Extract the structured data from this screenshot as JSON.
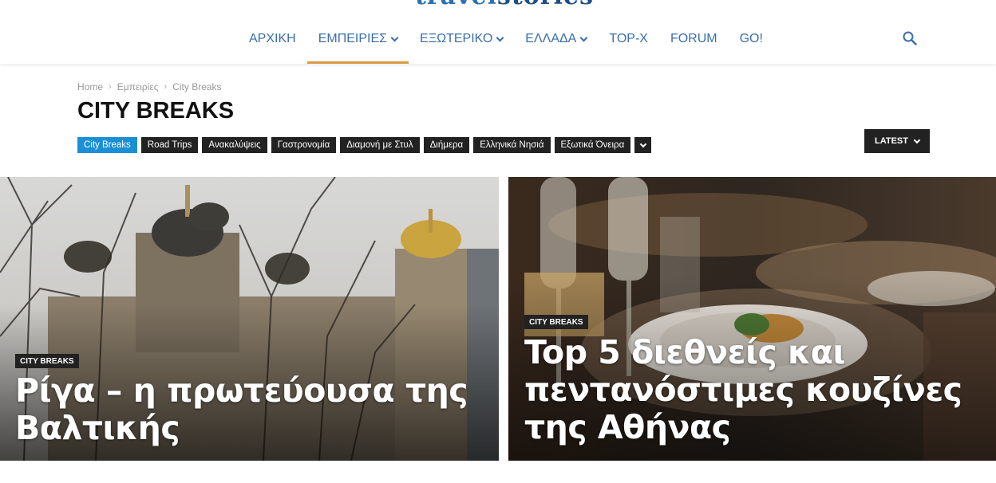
{
  "logo": {
    "part_a": "travel",
    "part_b": "stories"
  },
  "nav": {
    "items": [
      {
        "label": "ΑΡΧΙΚΗ",
        "dropdown": false
      },
      {
        "label": "ΕΜΠΕΙΡΙΕΣ",
        "dropdown": true,
        "active": true
      },
      {
        "label": "ΕΞΩΤΕΡΙΚΟ",
        "dropdown": true
      },
      {
        "label": "ΕΛΛΑΔΑ",
        "dropdown": true
      },
      {
        "label": "TOP-X",
        "dropdown": false
      },
      {
        "label": "FORUM",
        "dropdown": false
      },
      {
        "label": "GO!",
        "dropdown": false
      }
    ],
    "search_icon": "search-icon"
  },
  "breadcrumb": {
    "items": [
      "Home",
      "Εμπειρίες",
      "City Breaks"
    ],
    "separator": "›"
  },
  "page": {
    "title": "CITY BREAKS"
  },
  "categories": {
    "items": [
      "City Breaks",
      "Road Trips",
      "Ανακαλύψεις",
      "Γαστρονομία",
      "Διαμονή με Στυλ",
      "Διήμερα",
      "Ελληνικά Νησιά",
      "Εξωτικά Όνειρα"
    ],
    "active_index": 0
  },
  "sort": {
    "label": "LATEST"
  },
  "cards": [
    {
      "badge": "CITY BREAKS",
      "title": "Ρίγα – η πρωτεύουσα της Βαλτικής"
    },
    {
      "badge": "CITY BREAKS",
      "title": "Top 5 διεθνείς και πεντανόστιμες κουζίνες της Αθήνας"
    }
  ],
  "colors": {
    "nav_text": "#3a6ea9",
    "nav_active_underline": "#d99a43",
    "pill_active": "#1a8fd6",
    "pill": "#222222"
  }
}
